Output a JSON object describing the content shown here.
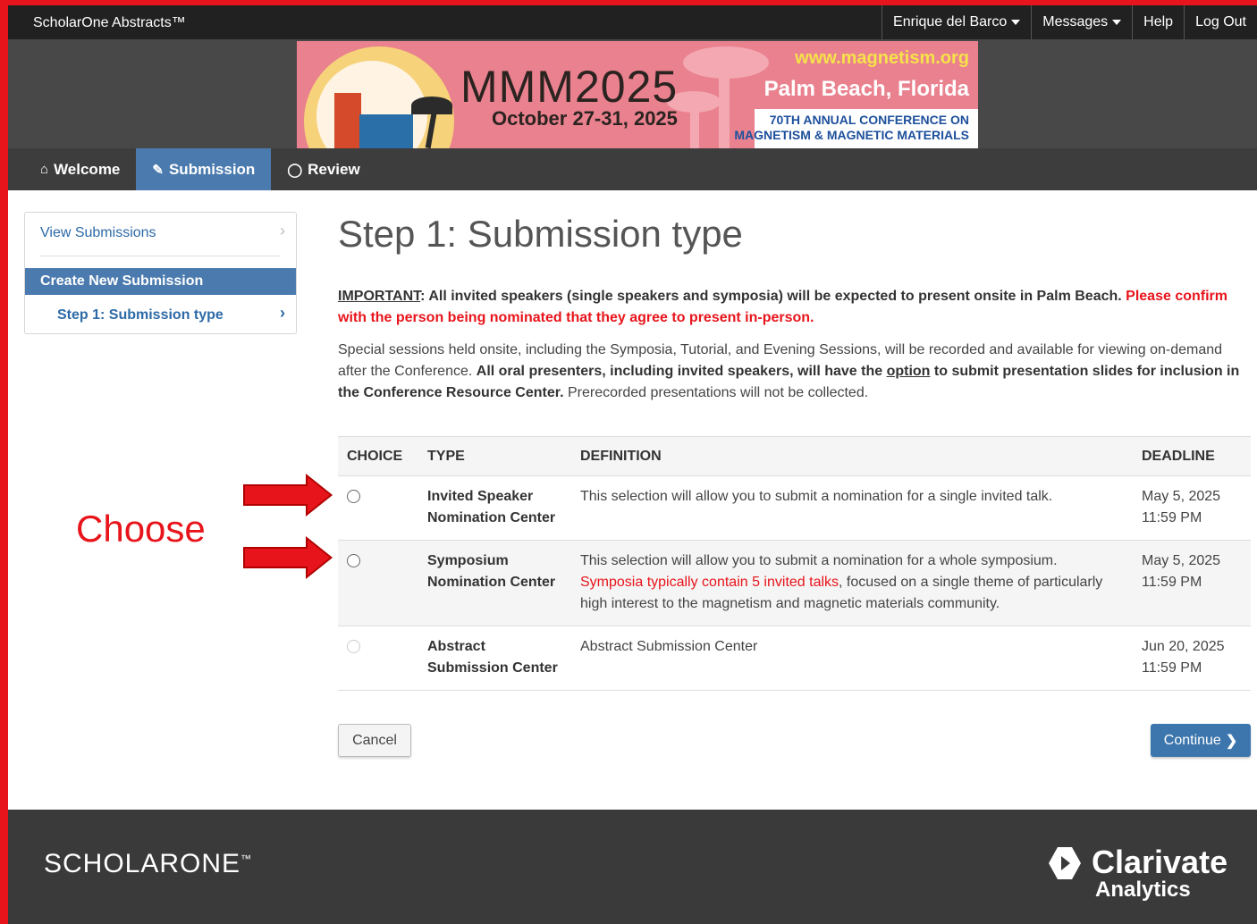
{
  "topbar": {
    "brand": "ScholarOne Abstracts™",
    "user_menu": "Enrique del Barco",
    "messages": "Messages",
    "help": "Help",
    "logout": "Log Out"
  },
  "banner": {
    "event": "MMM2025",
    "dates": "October 27-31, 2025",
    "url": "www.magnetism.org",
    "city": "Palm Beach, Florida",
    "conference_line1": "70TH ANNUAL CONFERENCE ON",
    "conference_line2": "MAGNETISM & MAGNETIC MATERIALS"
  },
  "nav": {
    "welcome": "Welcome",
    "submission": "Submission",
    "review": "Review"
  },
  "sidebar": {
    "view_submissions": "View Submissions",
    "create_new": "Create New Submission",
    "step1": "Step 1: Submission type"
  },
  "main": {
    "title": "Step 1: Submission type",
    "important_label": "IMPORTANT",
    "important_text": ":  All invited speakers (single speakers and symposia) will be expected to present onsite in Palm Beach.  ",
    "important_red": "Please confirm with the person being nominated that they agree to present in-person.",
    "info_text1": "Special sessions held onsite, including the Symposia, Tutorial, and Evening Sessions, will be recorded and available for viewing on-demand after the Conference. ",
    "info_bold1": "All oral presenters, including invited speakers, will have the ",
    "info_option": "option",
    "info_bold2": " to submit presentation slides for inclusion in the Conference Resource Center.",
    "info_text2": " Prerecorded presentations will not be collected."
  },
  "table": {
    "headers": [
      "CHOICE",
      "TYPE",
      "DEFINITION",
      "DEADLINE"
    ],
    "rows": [
      {
        "type_line1": "Invited Speaker",
        "type_line2": "Nomination Center",
        "definition": "This selection will allow you to submit a nomination for a single invited talk.",
        "definition_red": "",
        "definition_rest": "",
        "deadline_date": "May 5, 2025",
        "deadline_time": "11:59 PM"
      },
      {
        "type_line1": "Symposium",
        "type_line2": "Nomination Center",
        "definition": "This selection will allow you to submit a nomination for a whole symposium.",
        "definition_red": "Symposia typically contain 5 invited talks",
        "definition_rest": ", focused on a single theme of particularly high interest to the magnetism and magnetic materials community.",
        "deadline_date": "May 5, 2025",
        "deadline_time": "11:59 PM"
      },
      {
        "type_line1": "Abstract",
        "type_line2": "Submission Center",
        "definition": "Abstract Submission Center",
        "definition_red": "",
        "definition_rest": "",
        "deadline_date": "Jun 20, 2025",
        "deadline_time": "11:59 PM"
      }
    ]
  },
  "buttons": {
    "cancel": "Cancel",
    "continue": "Continue"
  },
  "annotation": {
    "choose": "Choose"
  },
  "footer": {
    "scholarone": "SCHOLARONE",
    "tm": "™",
    "clarivate": "Clarivate",
    "analytics": "Analytics"
  },
  "colors": {
    "accent_blue": "#4b7bae",
    "annotation_red": "#e8141b",
    "banner_pink": "#e9818e"
  }
}
